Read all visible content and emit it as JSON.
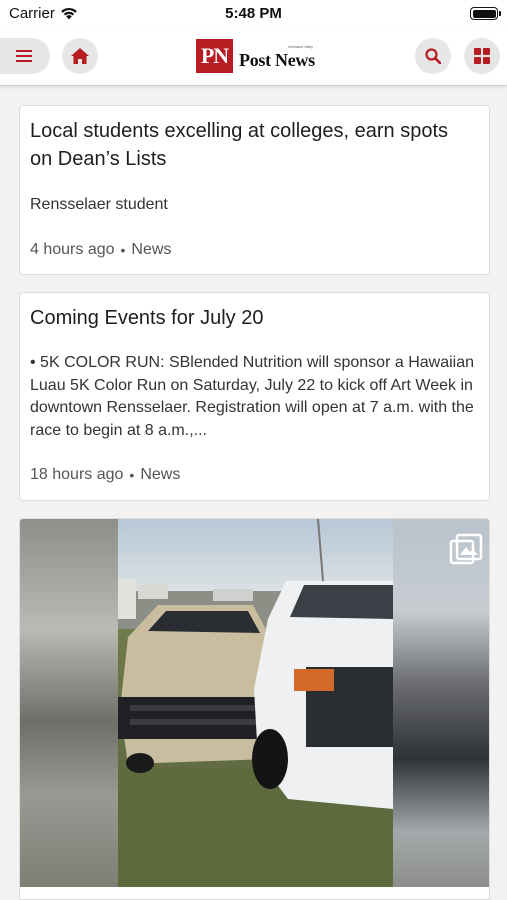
{
  "status_bar": {
    "carrier": "Carrier",
    "time": "5:48 PM",
    "battery_level": 1.0
  },
  "nav": {
    "menu_icon": "hamburger-menu-icon",
    "home_icon": "home-icon",
    "search_icon": "search-icon",
    "grid_icon": "grid-icon",
    "accent_color": "#b71c23",
    "button_bg": "#e6e6e6",
    "logo": {
      "initials": "PN",
      "name": "Post News",
      "tagline": "Kankakee Valley"
    }
  },
  "articles": [
    {
      "title": "Local students excelling at colleges, earn spots on Dean’s Lists",
      "summary": "Rensselaer student",
      "time": "4 hours ago",
      "separator": "•",
      "category": "News"
    },
    {
      "title": "Coming Events for July 20",
      "summary": "• 5K COLOR RUN: SBlended Nutrition will sponsor a Hawaiian Luau 5K Color Run on Saturday, July 22 to kick off Art Week in downtown Rensselaer. Registration will open at 7 a.m. with the race to begin at 8 a.m.,...",
      "time": "18 hours ago",
      "separator": "•",
      "category": "News"
    }
  ],
  "image_card": {
    "gallery_icon": "photo-gallery-icon"
  }
}
